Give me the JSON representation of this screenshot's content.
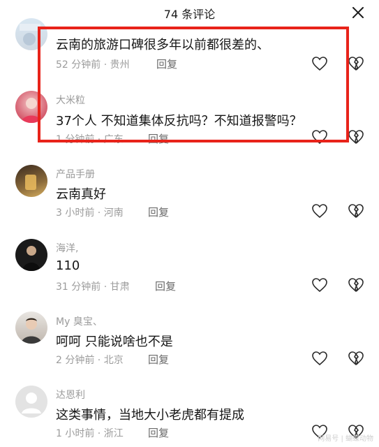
{
  "header": {
    "title": "74 条评论",
    "close_icon": "close-icon"
  },
  "comments": [
    {
      "username": "",
      "text": "云南的旅游口碑很多年以前都很差的、",
      "time": "52 分钟前",
      "location": "贵州",
      "reply": "回复"
    },
    {
      "username": "大米粒",
      "text": "37个人 不知道集体反抗吗？不知道报警吗？",
      "time": "1 分钟前",
      "location": "广东",
      "reply": "回复"
    },
    {
      "username": "产品手册",
      "text": "云南真好",
      "time": "3 小时前",
      "location": "河南",
      "reply": "回复"
    },
    {
      "username": "海洋,",
      "text": "110",
      "time": "31 分钟前",
      "location": "甘肃",
      "reply": "回复"
    },
    {
      "username": "My 臭宝、",
      "text": "呵呵 只能说啥也不是",
      "time": "2 分钟前",
      "location": "北京",
      "reply": "回复"
    },
    {
      "username": "达恩利",
      "text": "这类事情，当地大小老虎都有提成",
      "time": "1 小时前",
      "location": "浙江",
      "reply": "回复"
    }
  ],
  "watermark": "网易号 | 蝴蝶动物",
  "colors": {
    "highlight": "#e8231a",
    "meta": "#9b9b9b"
  }
}
